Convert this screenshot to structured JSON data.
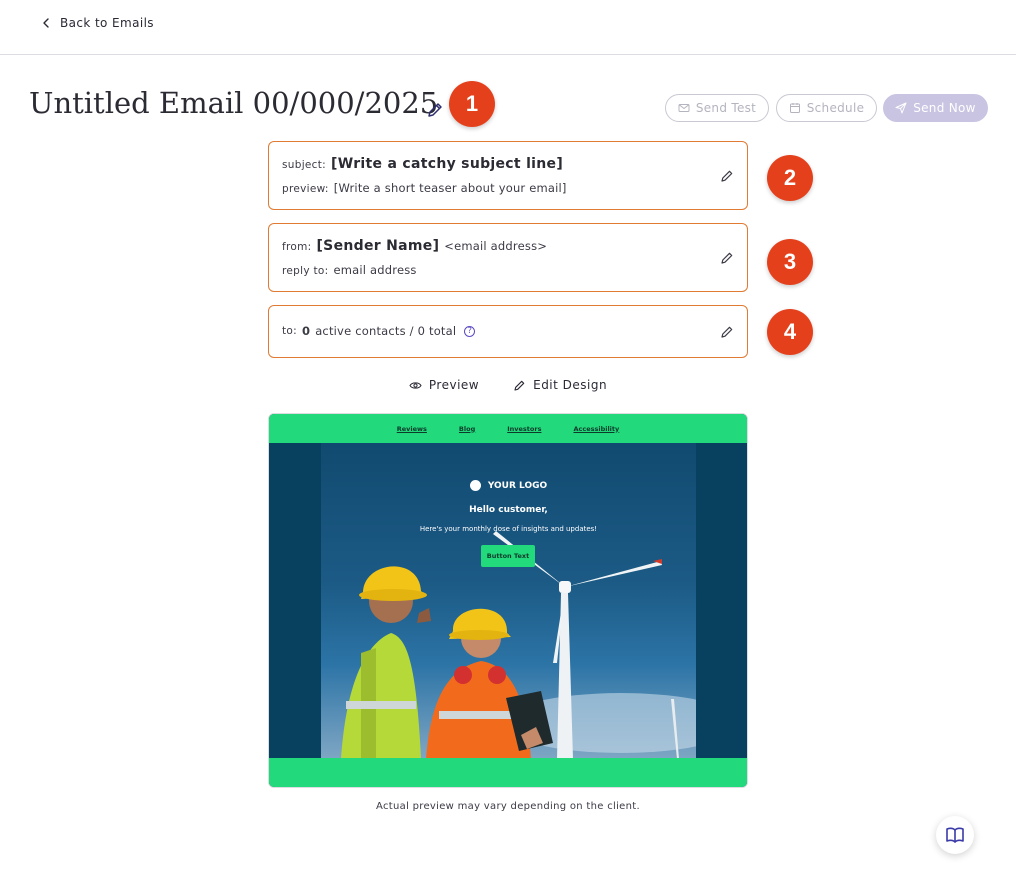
{
  "nav": {
    "back_label": "Back to Emails"
  },
  "header": {
    "title": "Untitled Email 00/000/2025",
    "send_test_label": "Send Test",
    "schedule_label": "Schedule",
    "send_now_label": "Send Now"
  },
  "markers": [
    "1",
    "2",
    "3",
    "4"
  ],
  "subject_card": {
    "subject_label": "subject:",
    "subject_value": "[Write a catchy subject line]",
    "preview_label": "preview:",
    "preview_value": "[Write a short teaser about your email]"
  },
  "from_card": {
    "from_label": "from:",
    "sender_name": "[Sender Name]",
    "sender_email": "<email address>",
    "reply_label": "reply to:",
    "reply_value": "email address"
  },
  "to_card": {
    "to_label": "to:",
    "count": "0",
    "summary": "active contacts / 0 total",
    "help_glyph": "?"
  },
  "actions": {
    "preview_label": "Preview",
    "edit_design_label": "Edit Design"
  },
  "email_preview": {
    "nav_links": [
      "Reviews",
      "Blog",
      "Investors",
      "Accessibility"
    ],
    "logo_text": "YOUR LOGO",
    "greeting": "Hello customer,",
    "subtitle": "Here's your monthly dose of insights and updates!",
    "button_label": "Button Text"
  },
  "footer_note": "Actual preview may vary depending on the client.",
  "colors": {
    "marker": "#e5401c",
    "card_border": "#e17a32",
    "email_green": "#22d97c",
    "email_dark": "#08405f",
    "primary_disabled": "#c8c4e2"
  },
  "icons": {
    "back": "chevron-left-icon",
    "edit": "pencil-icon",
    "send_test": "mail-icon",
    "schedule": "calendar-icon",
    "send_now": "send-icon",
    "preview": "eye-icon",
    "help": "help-circle-icon",
    "fab": "book-icon"
  }
}
